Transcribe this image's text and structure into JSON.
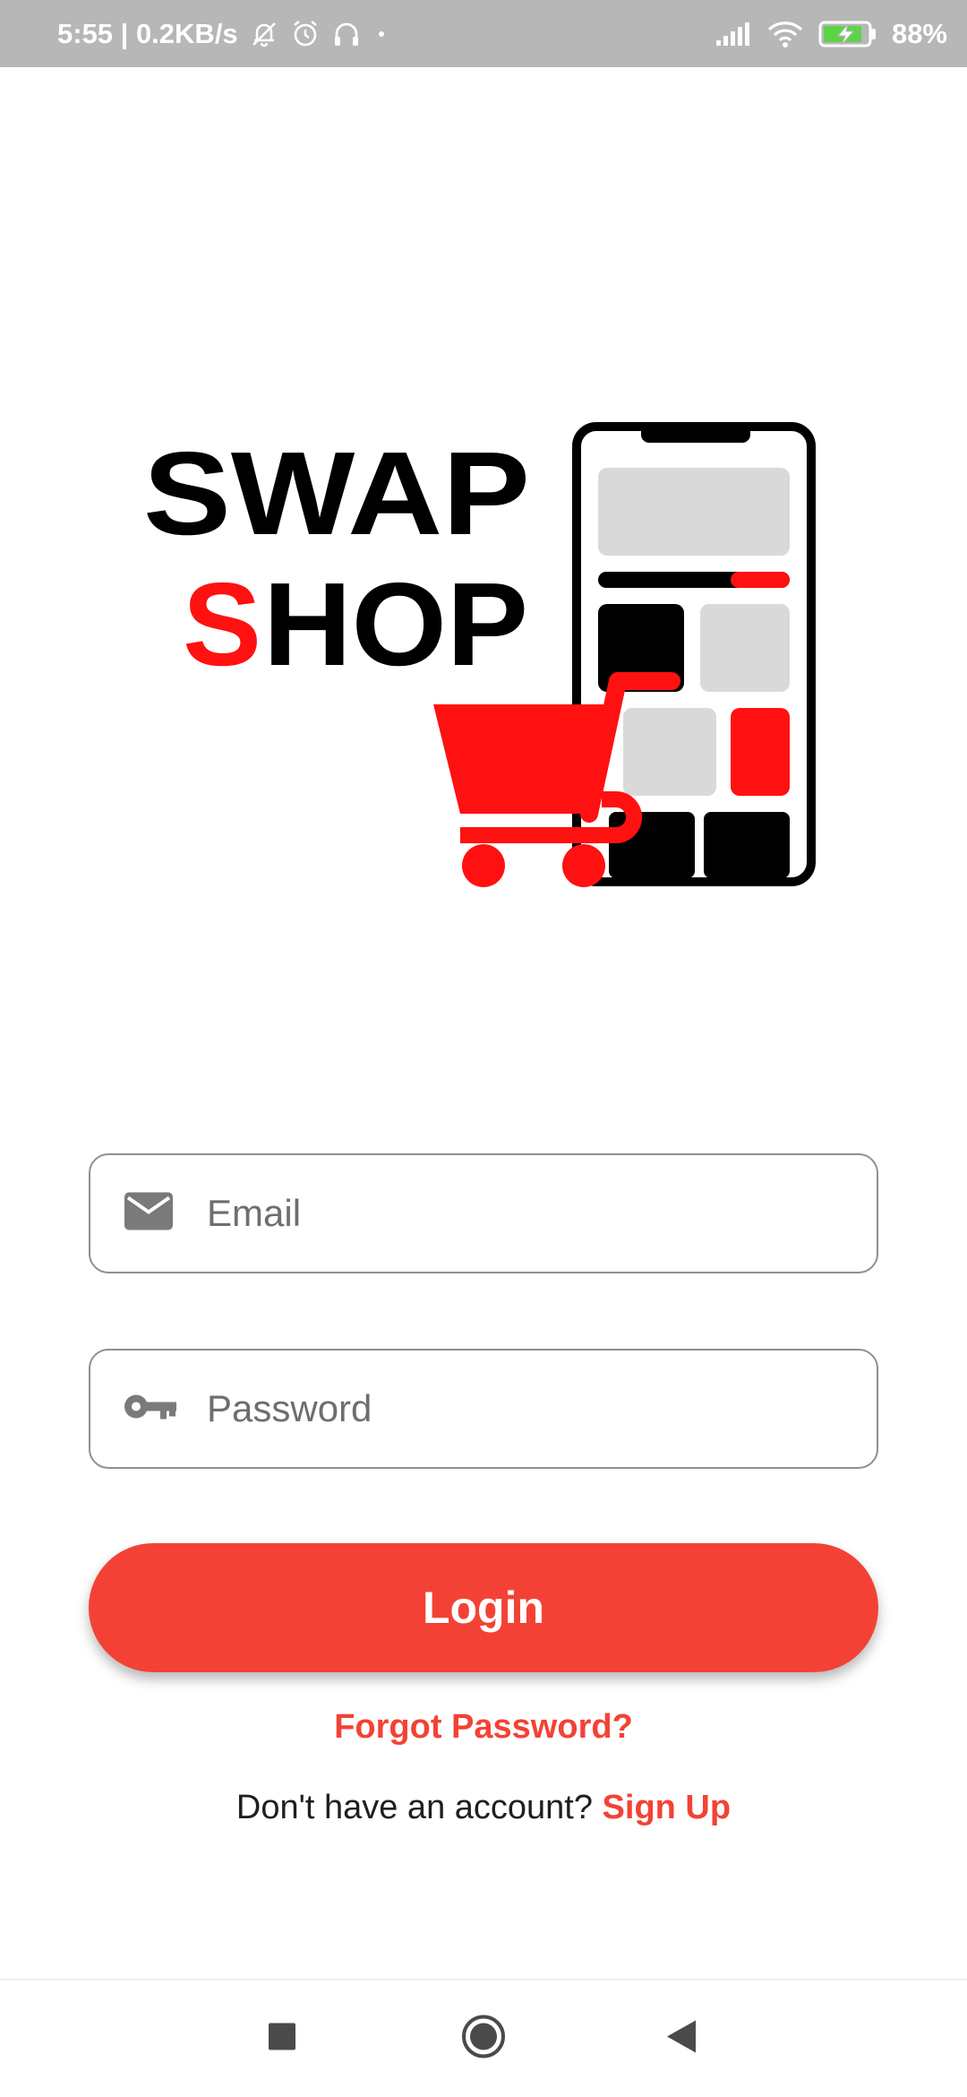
{
  "status_bar": {
    "time_speed": "5:55 | 0.2KB/s",
    "battery_percent": "88%",
    "icons": [
      "mute-bell-icon",
      "alarm-icon",
      "headphones-icon",
      "dot-icon",
      "signal-icon",
      "wifi-icon",
      "battery-charging-icon"
    ]
  },
  "logo": {
    "line1": "SWAP",
    "line2_accent": "S",
    "line2_rest": "HOP"
  },
  "form": {
    "email_placeholder": "Email",
    "email_value": "",
    "password_placeholder": "Password",
    "password_value": "",
    "login_label": "Login",
    "forgot_label": "Forgot Password?",
    "signup_prompt": "Don't have an account?",
    "signup_label": "Sign Up"
  },
  "nav": {
    "icons": [
      "recents-square-icon",
      "home-circle-icon",
      "back-triangle-icon"
    ]
  },
  "colors": {
    "accent": "#f34235",
    "logo_red": "#ff1111",
    "status_bar_bg": "#b7b7b7"
  }
}
